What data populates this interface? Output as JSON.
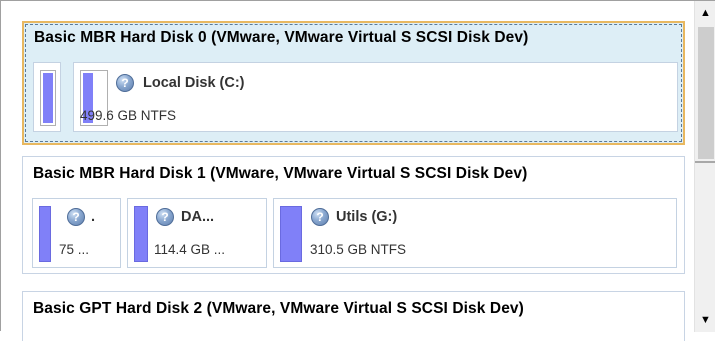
{
  "disks": [
    {
      "title": "Basic MBR Hard Disk 0 (VMware, VMware Virtual S SCSI Disk Dev)",
      "partitions": [
        {
          "label": "",
          "size": ""
        },
        {
          "label": "Local Disk (C:)",
          "size": "499.6 GB NTFS"
        }
      ]
    },
    {
      "title": "Basic MBR Hard Disk 1 (VMware, VMware Virtual S SCSI Disk Dev)",
      "partitions": [
        {
          "label": ".",
          "size": "75 ..."
        },
        {
          "label": "DA...",
          "size": "114.4 GB ..."
        },
        {
          "label": "Utils (G:)",
          "size": "310.5 GB NTFS"
        }
      ]
    },
    {
      "title": "Basic GPT Hard Disk 2 (VMware, VMware Virtual S SCSI Disk Dev)"
    }
  ],
  "icons": {
    "partition": "drive-question-icon",
    "scroll_up": "arrow-up-icon",
    "scroll_down": "arrow-down-icon"
  },
  "colors": {
    "selection_border": "#e8b860",
    "selection_fill": "#ddeef6",
    "partition_bar": "#8080f8"
  }
}
